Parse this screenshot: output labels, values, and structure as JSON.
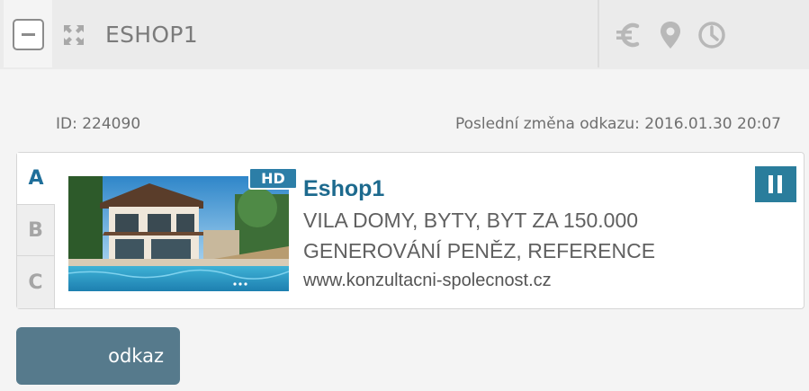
{
  "header": {
    "title": "ESHOP1",
    "icons": [
      "collapse-icon",
      "expand-icon",
      "euro-icon",
      "location-icon",
      "clock-icon"
    ]
  },
  "meta": {
    "id_text": "ID: 224090",
    "last_change_text": "Poslední změna odkazu: 2016.01.30 20:07"
  },
  "ad": {
    "tabs": [
      "A",
      "B",
      "C"
    ],
    "active_tab": "A",
    "badge": "HD",
    "title": "Eshop1",
    "line1": "VILA DOMY, BYTY, BYT ZA 150.000",
    "line2": "GENEROVÁNÍ PENĚZ, REFERENCE",
    "url": "www.konzultacni-spolecnost.cz"
  },
  "actions": {
    "link_label": "odkaz"
  },
  "colors": {
    "accent": "#2a7d9c",
    "title_blue": "#1d6a8e",
    "button": "#567a8c"
  }
}
